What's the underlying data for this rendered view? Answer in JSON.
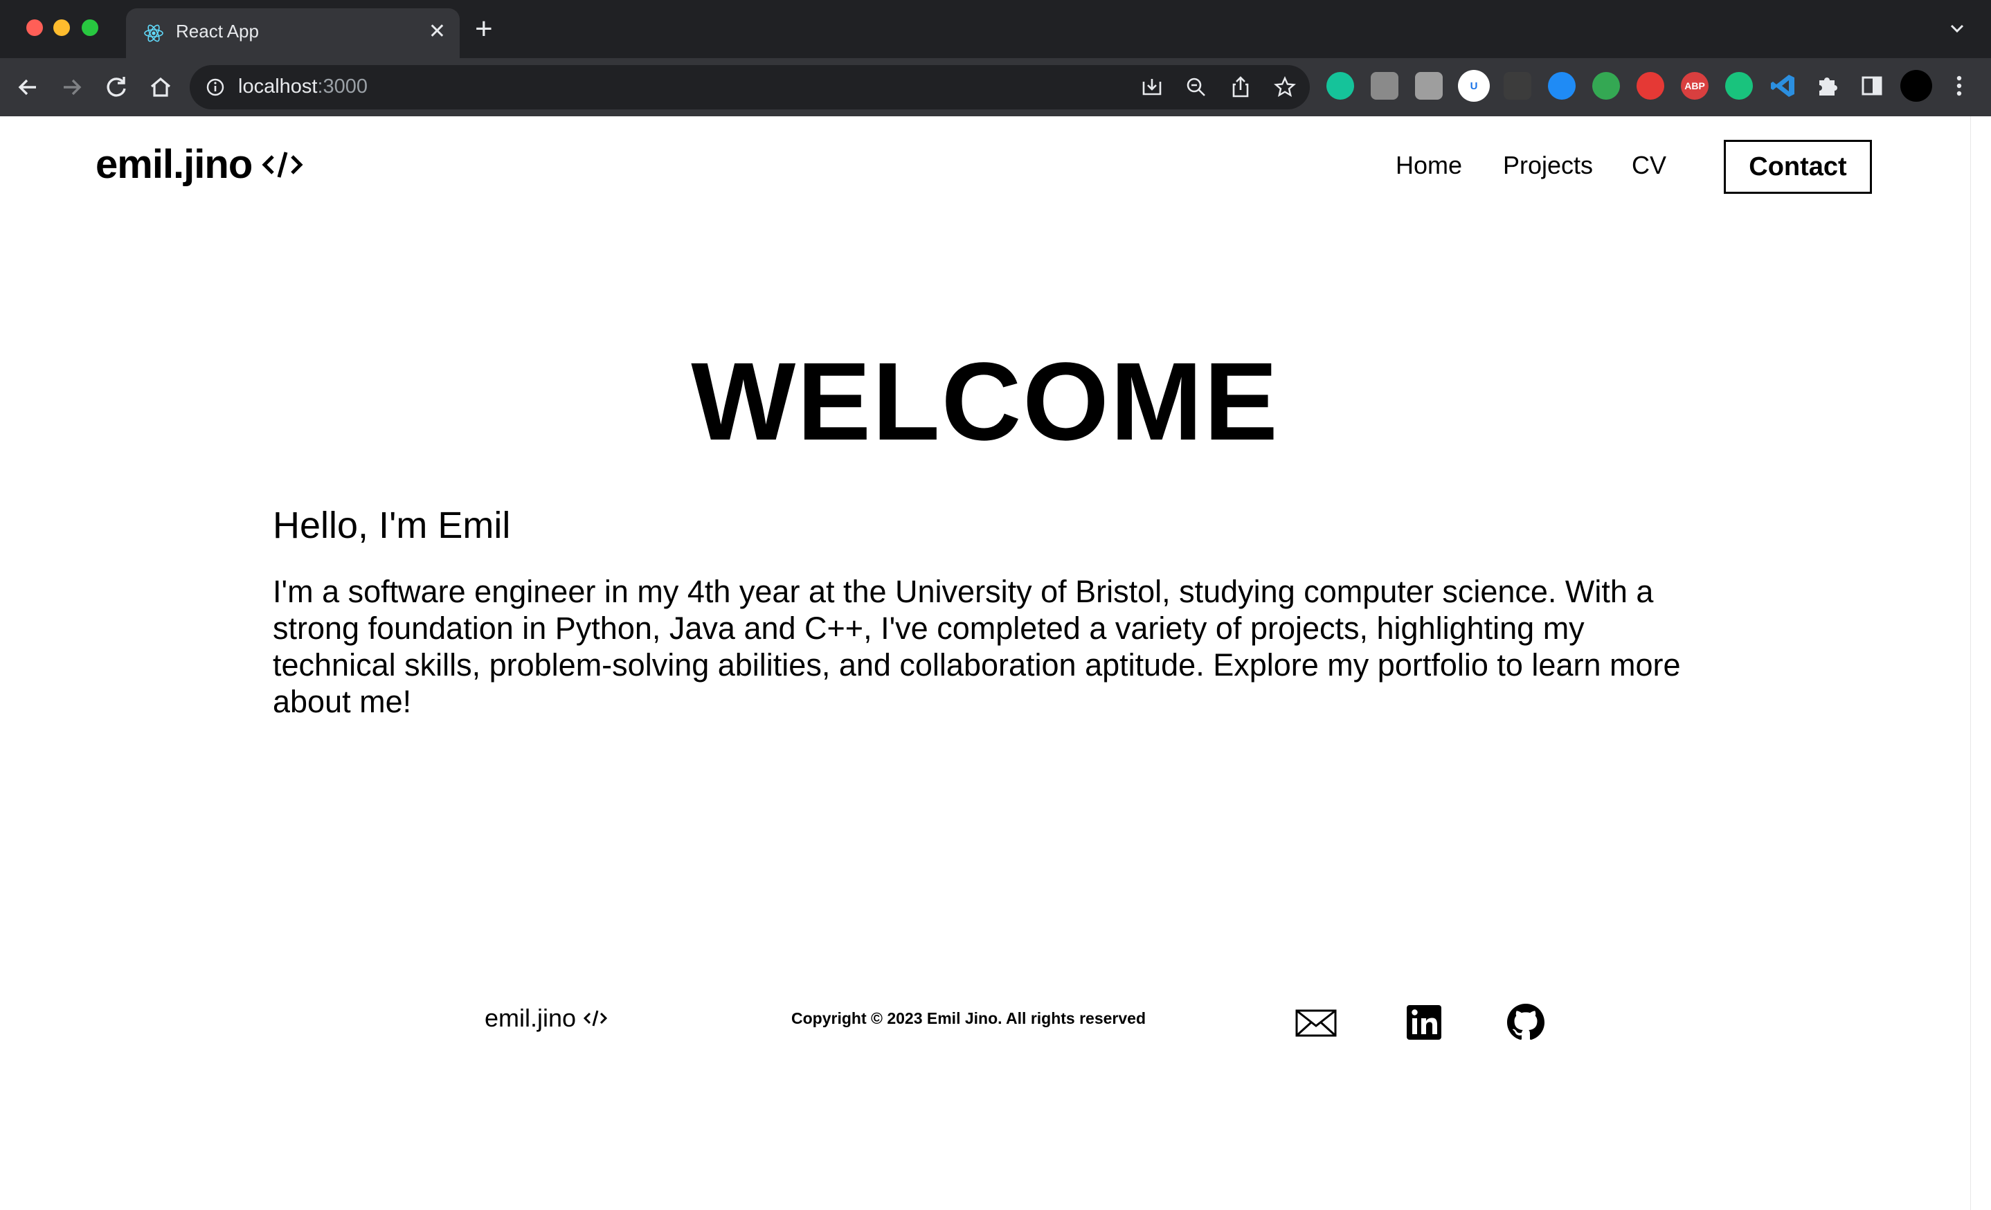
{
  "browser": {
    "tab_title": "React App",
    "tab_close": "✕",
    "new_tab": "+",
    "url_host": "localhost",
    "url_port": ":3000"
  },
  "extensions": [
    {
      "name": "grammarly",
      "color": "#15c39a",
      "label": ""
    },
    {
      "name": "ext-2",
      "color": "#8a8a8a",
      "label": ""
    },
    {
      "name": "ext-3",
      "color": "#9e9e9e",
      "label": ""
    },
    {
      "name": "ublock",
      "color": "#1a73e8",
      "label": "U"
    },
    {
      "name": "ext-glasses",
      "color": "#3c3c3c",
      "label": ""
    },
    {
      "name": "shazam",
      "color": "#1f8bf5",
      "label": ""
    },
    {
      "name": "ext-robot",
      "color": "#34a853",
      "label": ""
    },
    {
      "name": "ext-red",
      "color": "#e53935",
      "label": ""
    },
    {
      "name": "adblock-plus",
      "color": "#d93f3f",
      "label": "ABP"
    },
    {
      "name": "chatgpt",
      "color": "#19c37d",
      "label": ""
    },
    {
      "name": "vscode",
      "color": "#2b8fe0",
      "label": ""
    }
  ],
  "site": {
    "logo_text": "emil.jino",
    "nav": {
      "home": "Home",
      "projects": "Projects",
      "cv": "CV",
      "contact": "Contact"
    },
    "hero": {
      "title": "WELCOME",
      "greeting": "Hello, I'm Emil",
      "intro": "I'm a software engineer in my 4th year at the University of Bristol, studying computer science. With a strong foundation in Python, Java and C++, I've completed a variety of projects, highlighting my technical skills, problem-solving abilities, and collaboration aptitude. Explore my portfolio to learn more about me!"
    },
    "footer": {
      "logo_text": "emil.jino",
      "copyright": "Copyright © 2023 Emil Jino. All rights reserved",
      "social": [
        "mail-icon",
        "linkedin-icon",
        "github-icon"
      ]
    }
  }
}
